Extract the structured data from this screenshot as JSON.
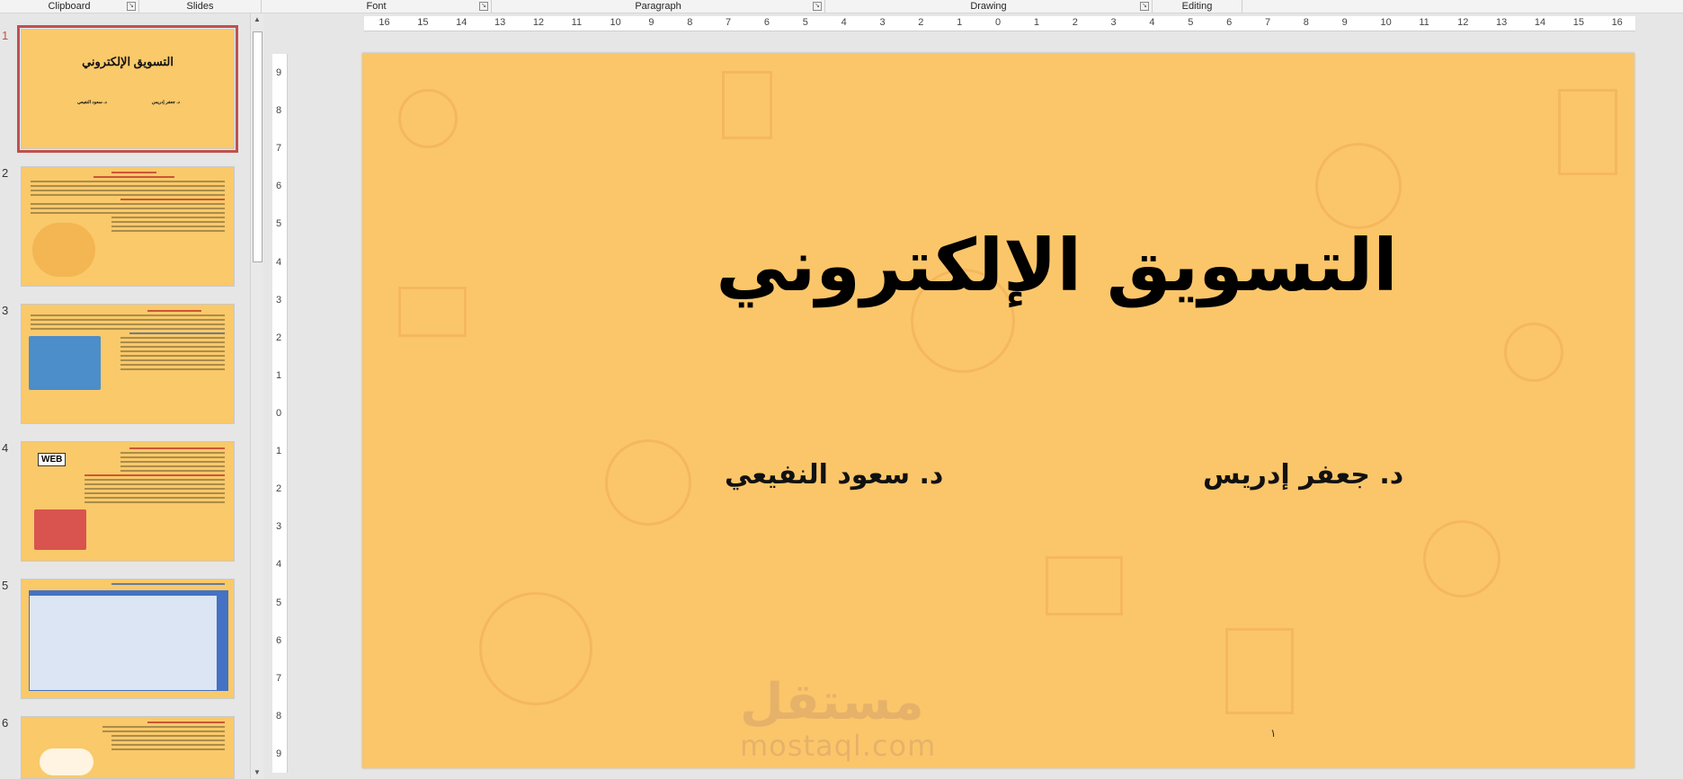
{
  "ribbon_groups": [
    {
      "label": "Clipboard",
      "launcher": true
    },
    {
      "label": "Slides",
      "launcher": false
    },
    {
      "label": "Font",
      "launcher": true
    },
    {
      "label": "Paragraph",
      "launcher": true
    },
    {
      "label": "Drawing",
      "launcher": true
    },
    {
      "label": "Editing",
      "launcher": false
    }
  ],
  "slides": [
    {
      "number": "1",
      "title": "التسويق الإلكتروني",
      "author_right": "د. جعفر إدريس",
      "author_left": "د. سعود النفيعي",
      "selected": true
    },
    {
      "number": "2"
    },
    {
      "number": "3"
    },
    {
      "number": "4",
      "image_label": "WEB"
    },
    {
      "number": "5"
    },
    {
      "number": "6"
    }
  ],
  "ruler": {
    "horizontal": [
      "16",
      "15",
      "14",
      "13",
      "12",
      "11",
      "10",
      "9",
      "8",
      "7",
      "6",
      "5",
      "4",
      "3",
      "2",
      "1",
      "0",
      "1",
      "2",
      "3",
      "4",
      "5",
      "6",
      "7",
      "8",
      "9",
      "10",
      "11",
      "12",
      "13",
      "14",
      "15",
      "16"
    ],
    "vertical": [
      "9",
      "8",
      "7",
      "6",
      "5",
      "4",
      "3",
      "2",
      "1",
      "0",
      "1",
      "2",
      "3",
      "4",
      "5",
      "6",
      "7",
      "8",
      "9"
    ]
  },
  "current_slide": {
    "title": "التسويق الإلكتروني",
    "author_right": "د. جعفر إدريس",
    "author_left": "د. سعود النفيعي",
    "watermark_arabic": "مستقل",
    "watermark_latin": "mostaql.com",
    "page_mark": "١"
  },
  "colors": {
    "slide_background": "#fbc66a",
    "selection": "#c0504d"
  }
}
